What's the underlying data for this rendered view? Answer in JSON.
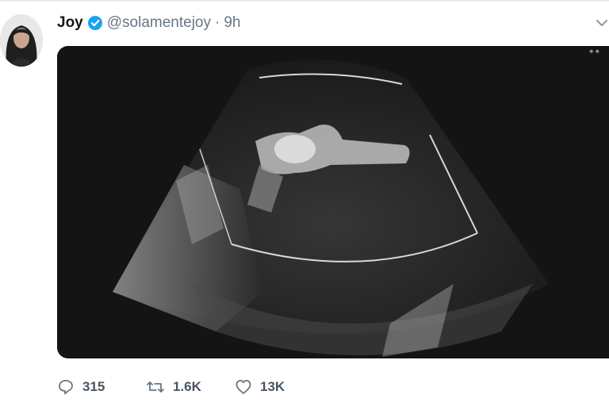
{
  "tweet": {
    "author_name": "Joy",
    "verified": true,
    "handle": "@solamentejoy",
    "separator": "·",
    "time": "9h",
    "media": {
      "type": "ultrasound-video",
      "icon": "video-media"
    },
    "actions": {
      "reply_count": "315",
      "retweet_count": "1.6K",
      "like_count": "13K"
    }
  },
  "icons": {
    "verified": "verified-badge-icon",
    "caret": "chevron-down-icon",
    "reply": "reply-icon",
    "retweet": "retweet-icon",
    "like": "heart-icon"
  },
  "colors": {
    "verified_blue": "#1da1f2",
    "secondary_text": "#657786",
    "icon_gray": "#657786"
  }
}
